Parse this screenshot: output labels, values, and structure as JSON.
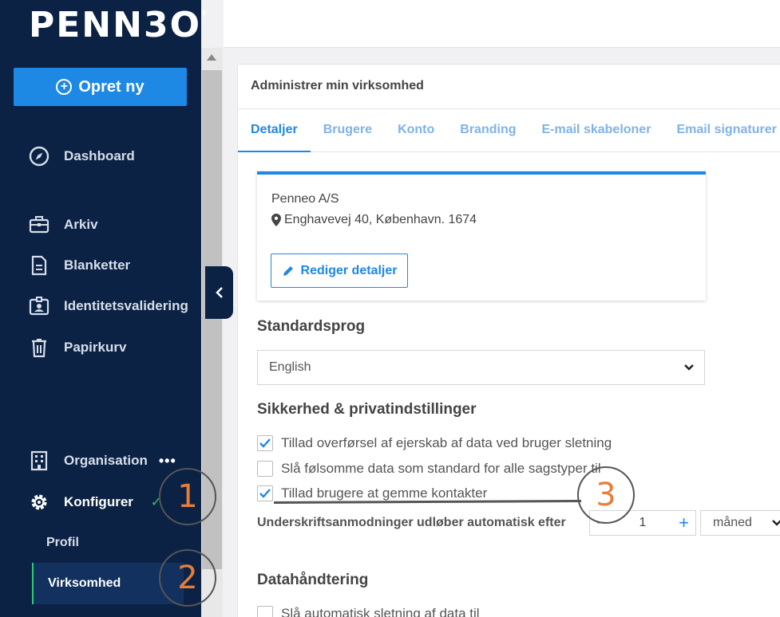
{
  "logo": {
    "text": "PENN3O",
    "mark": "®"
  },
  "sidebar": {
    "create_label": "Opret ny",
    "items": [
      {
        "label": "Dashboard",
        "icon": "compass-icon"
      },
      {
        "label": "Arkiv",
        "icon": "briefcase-icon"
      },
      {
        "label": "Blanketter",
        "icon": "document-icon"
      },
      {
        "label": "Identitetsvalidering",
        "icon": "id-badge-icon"
      },
      {
        "label": "Papirkurv",
        "icon": "trash-icon"
      },
      {
        "label": "Organisation",
        "icon": "building-icon",
        "more": "•••"
      },
      {
        "label": "Konfigurer",
        "icon": "gear-icon"
      }
    ],
    "sub_items": [
      {
        "label": "Profil"
      },
      {
        "label": "Virksomhed"
      }
    ]
  },
  "annotations": [
    "1",
    "2",
    "3"
  ],
  "main": {
    "header": "Administrer min virksomhed",
    "tabs": [
      "Detaljer",
      "Brugere",
      "Konto",
      "Branding",
      "E-mail skabeloner",
      "Email signaturer"
    ],
    "company": {
      "name": "Penneo A/S",
      "address": "Enghavevej 40, København. 1674",
      "edit_label": "Rediger detaljer"
    },
    "language": {
      "title": "Standardsprog",
      "value": "English"
    },
    "security": {
      "title": "Sikkerhed & privatindstillinger",
      "options": [
        {
          "label": "Tillad overførsel af ejerskab af data ved bruger sletning",
          "checked": true
        },
        {
          "label": "Slå følsomme data som standard for alle sagstyper til",
          "checked": false
        },
        {
          "label": "Tillad brugere at gemme kontakter",
          "checked": true
        }
      ],
      "expire_label": "Underskriftsanmodninger udløber automatisk efter",
      "expire_minus": "−",
      "expire_value": "1",
      "expire_plus": "+",
      "expire_unit": "måned"
    },
    "data_handling": {
      "title": "Datahåndtering",
      "options": [
        {
          "label": "Slå automatisk sletning af data til",
          "checked": false
        }
      ]
    }
  },
  "colors": {
    "sidebar": "#0b2244",
    "accent": "#1e88e5",
    "active_marker": "#2ecc71",
    "annotation": "#e67e3a"
  }
}
